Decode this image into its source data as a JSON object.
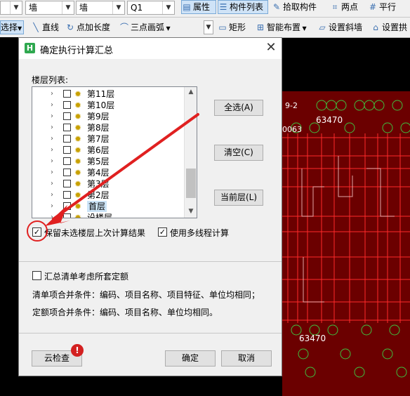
{
  "toolbar1": {
    "combo_partial": "",
    "combo_category": "墙",
    "combo_type": "墙",
    "combo_code": "Q1",
    "properties": "属性",
    "component_list": "构件列表",
    "pick_component": "拾取构件",
    "two_points": "两点",
    "parallel": "平行"
  },
  "toolbar2": {
    "select": "选择",
    "line": "直线",
    "point_length": "点加长度",
    "three_point_arc": "三点画弧",
    "rectangle": "矩形",
    "smart_layout": "智能布置",
    "set_slope_wall": "设置斜墙",
    "set_arch": "设置拱"
  },
  "dialog": {
    "title": "确定执行计算汇总",
    "list_label": "楼层列表:",
    "floors": [
      "第11层",
      "第10层",
      "第9层",
      "第8层",
      "第7层",
      "第6层",
      "第5层",
      "第4层",
      "第3层",
      "第2层",
      "首层",
      "设楼层"
    ],
    "select_all": "全选(A)",
    "clear": "清空(C)",
    "current_floor": "当前层(L)",
    "keep_unselected": "保留未选楼层上次计算结果",
    "multithread": "使用多线程计算",
    "summary_quota": "汇总清单考虑所套定额",
    "list_merge": "清单项合并条件：编码、项目名称、项目特征、单位均相同；",
    "quota_merge": "定额项合并条件：编码、项目名称、单位均相同。",
    "cloud_check": "云检查",
    "badge": "!",
    "ok": "确定",
    "cancel": "取消"
  },
  "cad": {
    "text_a": "9-2",
    "text_b": "63470",
    "text_c": "0063",
    "text_d": "63470"
  },
  "colors": {
    "accent_red": "#e02020",
    "cad_bg": "#6b0000",
    "cad_line": "#ff2a2a",
    "cad_green": "#3fbf3f"
  }
}
